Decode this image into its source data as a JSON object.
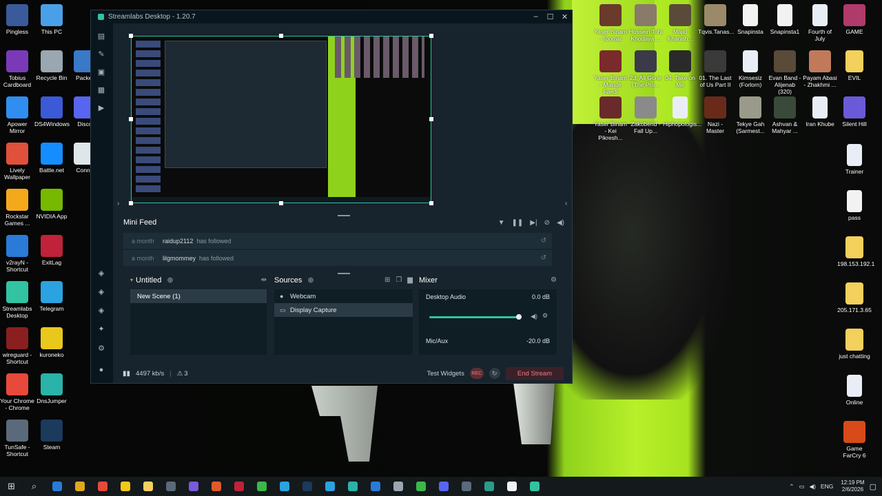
{
  "window": {
    "title": "Streamlabs Desktop - 1.20.7"
  },
  "minifeed": {
    "title": "Mini Feed",
    "items": [
      {
        "time": "a month",
        "user": "raidup2112",
        "action": "has followed"
      },
      {
        "time": "a month",
        "user": "lilgmommey",
        "action": "has followed"
      }
    ]
  },
  "scenes": {
    "collection": "Untitled",
    "items": [
      "New Scene (1)"
    ]
  },
  "sources": {
    "title": "Sources",
    "items": [
      "Webcam",
      "Display Capture"
    ]
  },
  "mixer": {
    "title": "Mixer",
    "channels": [
      {
        "name": "Desktop Audio",
        "level": "0.0 dB"
      },
      {
        "name": "Mic/Aux",
        "level": "-20.0 dB"
      }
    ]
  },
  "status": {
    "bitrate": "4497 kb/s",
    "alerts": "3",
    "test_widgets": "Test Widgets",
    "rec_label": "REC",
    "end_stream": "End Stream"
  },
  "desktop_left": [
    {
      "label": "Pingless",
      "color": "#3a5a9a"
    },
    {
      "label": "This PC",
      "color": "#4aa0e8"
    },
    {
      "label": "Tobius Cardboard",
      "color": "#7a3ab8"
    },
    {
      "label": "Recycle Bin",
      "color": "#9aa7b0"
    },
    {
      "label": "Packet",
      "color": "#3a78c8"
    },
    {
      "label": "Apower Mirror",
      "color": "#2f8ef0"
    },
    {
      "label": "DS4Windows",
      "color": "#3c5ad8"
    },
    {
      "label": "Disco",
      "color": "#5865f2"
    },
    {
      "label": "Lively Wallpaper",
      "color": "#e0503a"
    },
    {
      "label": "Battle.net",
      "color": "#148eff"
    },
    {
      "label": "Conne",
      "color": "#dfe6ea"
    },
    {
      "label": "Rockstar Games ...",
      "color": "#f4a81c"
    },
    {
      "label": "NVIDIA App",
      "color": "#76b900"
    },
    {
      "label": "v2rayN - Shortcut",
      "color": "#2a7ad8"
    },
    {
      "label": "ExitLag",
      "color": "#c0223a"
    },
    {
      "label": "Streamlabs Desktop",
      "color": "#31c3a2"
    },
    {
      "label": "Telegram",
      "color": "#2aa3e0"
    },
    {
      "label": "wireguard - Shortcut",
      "color": "#8a1f1f"
    },
    {
      "label": "kuroneko",
      "color": "#e8c81a"
    },
    {
      "label": "Your Chrome - Chrome",
      "color": "#e8493a"
    },
    {
      "label": "DnsJumper",
      "color": "#2ab3a8"
    },
    {
      "label": "TunSafe - Shortcut",
      "color": "#5a6a7a"
    },
    {
      "label": "Steam",
      "color": "#1b3a5c"
    }
  ],
  "desktop_right": [
    {
      "label": "Yaser Binam - Toomar",
      "color": "#6a3a2a"
    },
    {
      "label": "Hossein Tohi Khodaya ...",
      "color": "#8a7a6a"
    },
    {
      "label": "Majid Kharath...",
      "color": "#5a4a3a"
    },
    {
      "label": "Tqvis.Tanas...",
      "color": "#9a8a6a"
    },
    {
      "label": "Snapinsta",
      "color": "#f2f2f2"
    },
    {
      "label": "Snapinsta1",
      "color": "#f2f2f2"
    },
    {
      "label": "Fourth of July",
      "color": "#e9eef6"
    },
    {
      "label": "GAME",
      "color": "#b03a6a"
    },
    {
      "label": "Yaser Binam - Mande Faedi",
      "color": "#7a2a2a"
    },
    {
      "label": "23. All Gone (The Pro...",
      "color": "#3a3a4a"
    },
    {
      "label": "04. Take on Me",
      "color": "#2a2a2a"
    },
    {
      "label": "01. The Last of Us Part II",
      "color": "#3a3a3a"
    },
    {
      "label": "Kimsesiz (Forlorn)",
      "color": "#e9eef6"
    },
    {
      "label": "Evan Band - Alijenab (320)",
      "color": "#5a4a3a"
    },
    {
      "label": "Payam Abasi - Zhakhmi ...",
      "color": "#c07a5a"
    },
    {
      "label": "EVIL",
      "color": "#f4d05c"
    },
    {
      "label": "Yaser Binam - Kei Pikresh...",
      "color": "#6a2a2a"
    },
    {
      "label": "Zakobend - Fall Up...",
      "color": "#8a8a8a"
    },
    {
      "label": "Hiphopologis...",
      "color": "#e9eef6"
    },
    {
      "label": "Nazi - Master",
      "color": "#6a2a1a"
    },
    {
      "label": "Tekye Gah (Sarmest...",
      "color": "#9a9a8a"
    },
    {
      "label": "Ashvan & Mahyar ...",
      "color": "#3a4a3a"
    },
    {
      "label": "Iran Khube",
      "color": "#e9eef6"
    },
    {
      "label": "Silent Hill",
      "color": "#6a5ad8"
    },
    {
      "label": "Trainer",
      "color": "#e9eef6"
    },
    {
      "label": "pass",
      "color": "#f2f2f2"
    },
    {
      "label": "198.153.192.1",
      "color": "#f4d05c"
    },
    {
      "label": "205.171.3.65",
      "color": "#f4d05c"
    },
    {
      "label": "just chatting",
      "color": "#f4d05c"
    },
    {
      "label": "Online",
      "color": "#e9eef6"
    },
    {
      "label": "Game FarCry 6",
      "color": "#d84a1a"
    }
  ],
  "taskbar": {
    "apps": [
      "#2a7ad8",
      "#e0a81c",
      "#e8493a",
      "#f2c81a",
      "#f4d05c",
      "#5a6a7a",
      "#7a5ad8",
      "#e05a2a",
      "#c0223a",
      "#3ab84a",
      "#2aa3e0",
      "#1b3a5c",
      "#2aa3e0",
      "#2ab3a8",
      "#2a7ad8",
      "#9aa7b0",
      "#3ab84a",
      "#5865f2",
      "#5a6a7a",
      "#2a9a8a",
      "#f2f2f2",
      "#31c3a2"
    ],
    "lang": "ENG",
    "time": "12:19 PM",
    "date": "2/6/2026"
  }
}
